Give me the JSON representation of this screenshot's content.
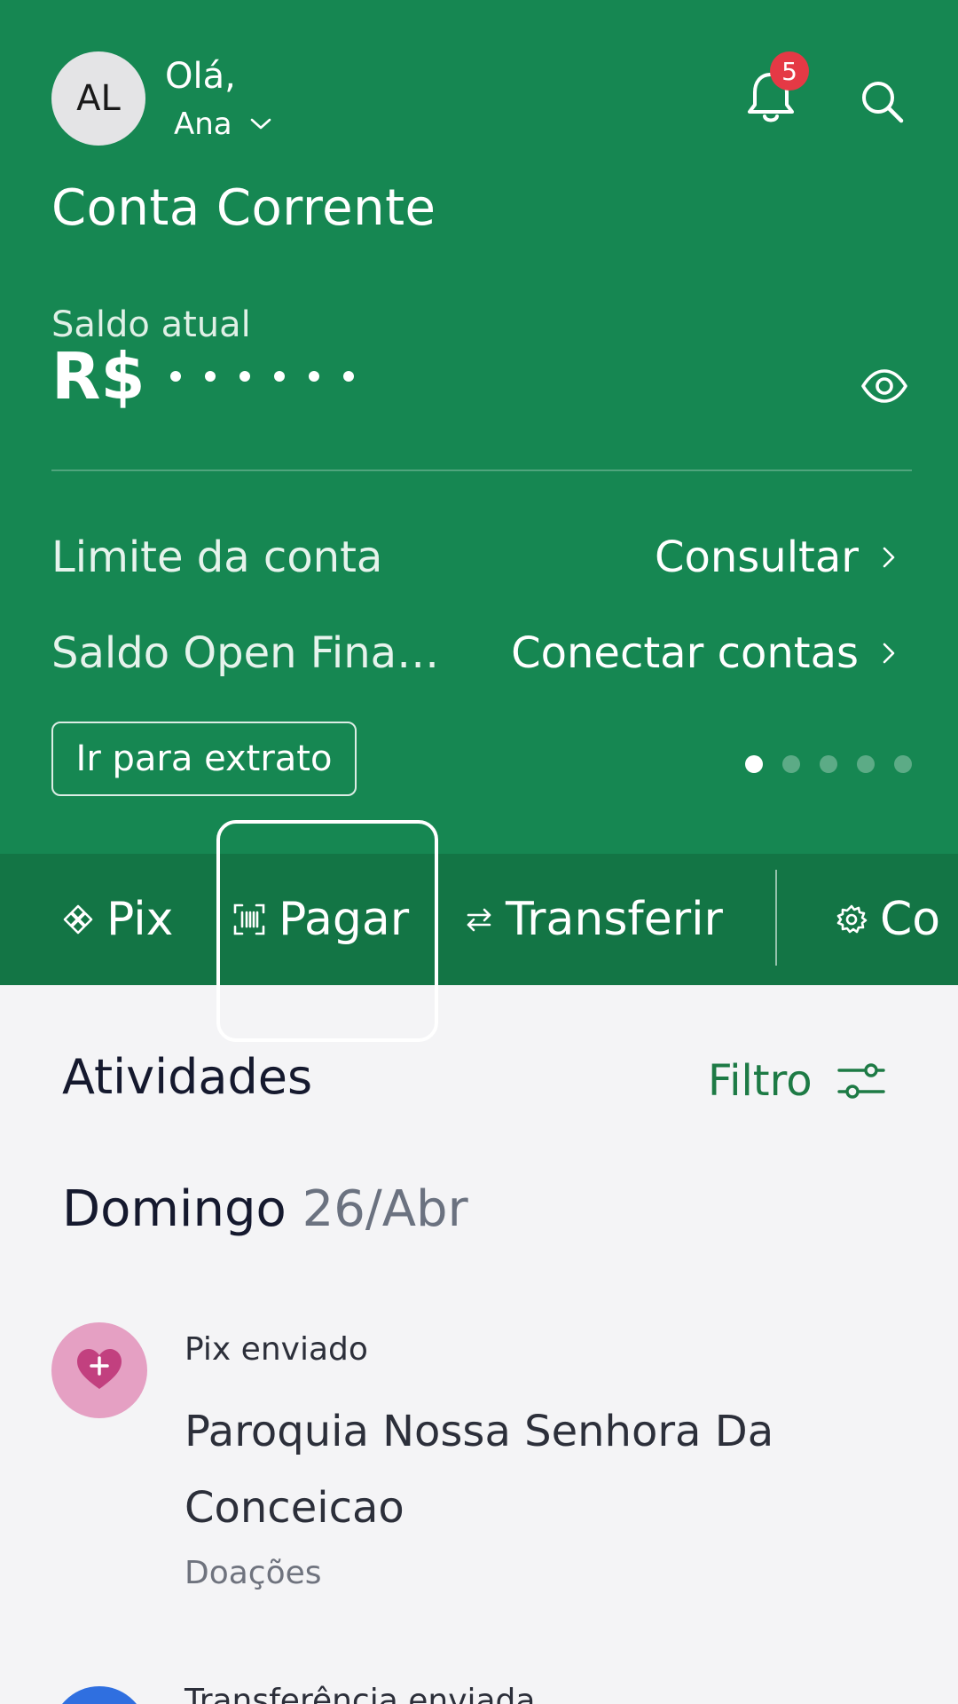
{
  "header": {
    "avatar_initials": "AL",
    "greeting": "Olá,",
    "user_name": "Ana",
    "notifications_count": "5",
    "account_title": "Conta Corrente",
    "balance_label": "Saldo atual",
    "balance_currency": "R$",
    "balance_hidden_mask": "• • • • • •",
    "rows": [
      {
        "label": "Limite da conta",
        "action": "Consultar"
      },
      {
        "label": "Saldo Open Fina…",
        "action": "Conectar contas"
      }
    ],
    "statement_button": "Ir para extrato",
    "pager": {
      "count": 5,
      "active_index": 0
    }
  },
  "actions": [
    {
      "label": "Pix",
      "icon": "pix-icon"
    },
    {
      "label": "Pagar",
      "icon": "barcode-icon"
    },
    {
      "label": "Transferir",
      "icon": "transfer-icon"
    },
    {
      "label": "Co",
      "icon": "gear-icon"
    }
  ],
  "activities": {
    "title": "Atividades",
    "filter_label": "Filtro",
    "date_day": "Domingo",
    "date_num": "26/Abr",
    "transactions": [
      {
        "type": "Pix enviado",
        "name": "Paroquia Nossa Senhora Da Conceicao",
        "category": "Doações",
        "icon": "heart-plus-icon"
      },
      {
        "type": "Transferência enviada",
        "icon": "transfer-avatar-icon"
      }
    ]
  },
  "colors": {
    "header_green": "#168752",
    "actions_green": "#137545",
    "badge_red": "#e53945",
    "filter_green": "#1d7a45",
    "background": "#f4f4f6"
  }
}
